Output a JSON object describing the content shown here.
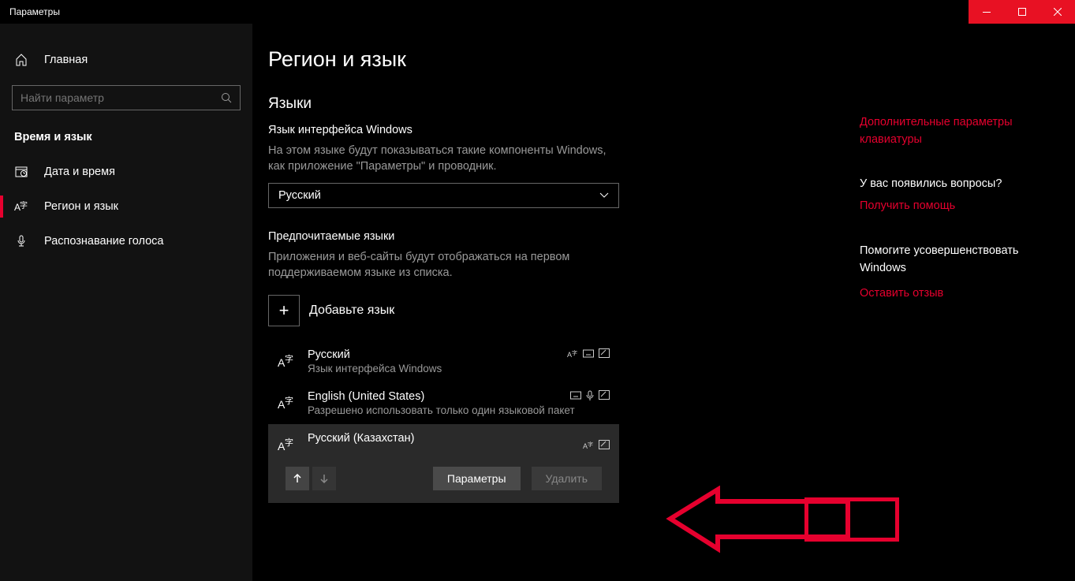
{
  "titlebar": {
    "title": "Параметры"
  },
  "sidebar": {
    "home": "Главная",
    "search_placeholder": "Найти параметр",
    "section": "Время и язык",
    "items": [
      {
        "label": "Дата и время",
        "icon": "calendar"
      },
      {
        "label": "Регион и язык",
        "icon": "language",
        "active": true
      },
      {
        "label": "Распознавание голоса",
        "icon": "mic"
      }
    ]
  },
  "main": {
    "title": "Регион и язык",
    "langs_heading": "Языки",
    "interface_label": "Язык интерфейса Windows",
    "interface_desc": "На этом языке будут показываться такие компоненты Windows, как приложение \"Параметры\" и проводник.",
    "interface_value": "Русский",
    "preferred_label": "Предпочитаемые языки",
    "preferred_desc": "Приложения и веб-сайты будут отображаться на первом поддерживаемом языке из списка.",
    "add_lang": "Добавьте язык",
    "languages": [
      {
        "name": "Русский",
        "sub": "Язык интерфейса Windows",
        "badges": [
          "display",
          "keyboard",
          "handwriting"
        ],
        "selected": false
      },
      {
        "name": "English (United States)",
        "sub": "Разрешено использовать только один языковой пакет",
        "badges": [
          "keyboard",
          "voice",
          "handwriting"
        ],
        "selected": false
      },
      {
        "name": "Русский (Казахстан)",
        "sub": "",
        "badges": [
          "display",
          "handwriting"
        ],
        "selected": true
      }
    ],
    "btn_params": "Параметры",
    "btn_delete": "Удалить"
  },
  "aside": {
    "kb_link": "Дополнительные параметры клавиатуры",
    "q_head": "У вас появились вопросы?",
    "q_link": "Получить помощь",
    "f_head": "Помогите усовершенствовать Windows",
    "f_link": "Оставить отзыв"
  }
}
